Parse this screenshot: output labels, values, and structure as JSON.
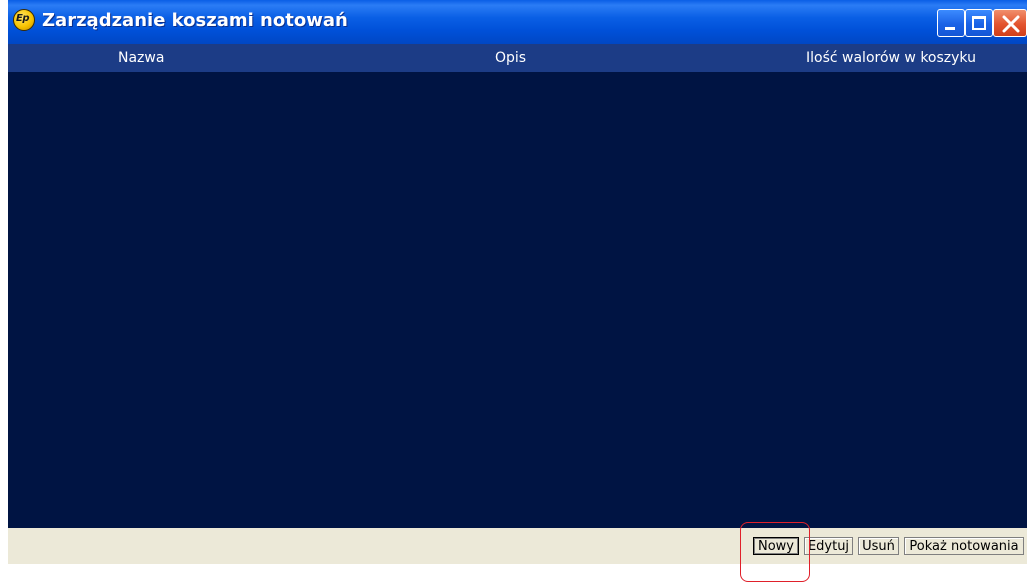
{
  "window": {
    "title": "Zarządzanie koszami notowań",
    "icon_text": "Ep",
    "icon": "app-logo-icon"
  },
  "controls": {
    "minimize": "minimize-icon",
    "maximize": "maximize-icon",
    "close": "close-icon"
  },
  "list": {
    "columns": [
      "Nazwa",
      "Opis",
      "Ilość walorów w koszyku"
    ],
    "rows": []
  },
  "actions": {
    "new_label": "Nowy",
    "edit_label": "Edytuj",
    "delete_label": "Usuń",
    "show_label": "Pokaż notowania"
  },
  "colors": {
    "title_bar": "#0054e3",
    "list_background": "#001443",
    "header_background": "#1c3c86",
    "status_bar": "#ece9d8",
    "highlight": "#e0202a"
  }
}
